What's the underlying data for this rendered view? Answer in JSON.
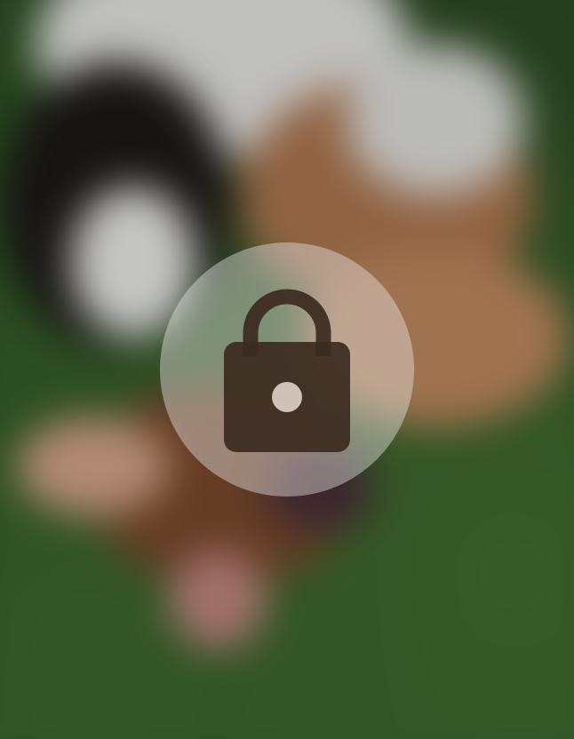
{
  "overlay": {
    "icon": "lock-icon",
    "badge_color": "#e6e6e6",
    "icon_color": "#3b2a1f"
  },
  "background": {
    "description_visible": false
  }
}
